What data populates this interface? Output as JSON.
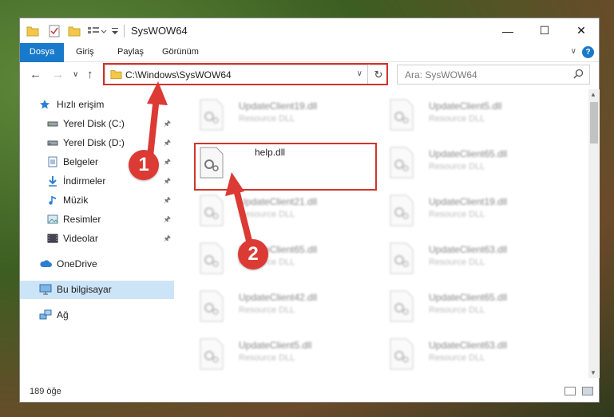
{
  "window": {
    "title": "SysWOW64",
    "controls": {
      "minimize": "—",
      "maximize": "☐",
      "close": "✕"
    }
  },
  "ribbon": {
    "tabs": [
      "Dosya",
      "Giriş",
      "Paylaş",
      "Görünüm"
    ],
    "help": "?"
  },
  "address": {
    "path": "C:\\Windows\\SysWOW64",
    "search_placeholder": "Ara: SysWOW64"
  },
  "nav": {
    "items": [
      {
        "label": "Hızlı erişim",
        "icon": "star-icon",
        "pinned": false
      },
      {
        "label": "Yerel Disk (C:)",
        "icon": "drive-icon",
        "pinned": true
      },
      {
        "label": "Yerel Disk (D:)",
        "icon": "drive-icon",
        "pinned": true
      },
      {
        "label": "Belgeler",
        "icon": "documents-icon",
        "pinned": true
      },
      {
        "label": "İndirmeler",
        "icon": "download-icon",
        "pinned": true
      },
      {
        "label": "Müzik",
        "icon": "music-icon",
        "pinned": true
      },
      {
        "label": "Resimler",
        "icon": "pictures-icon",
        "pinned": true
      },
      {
        "label": "Videolar",
        "icon": "videos-icon",
        "pinned": true
      },
      {
        "label": "OneDrive",
        "icon": "cloud-icon",
        "pinned": false
      },
      {
        "label": "Bu bilgisayar",
        "icon": "computer-icon",
        "pinned": false
      },
      {
        "label": "Ağ",
        "icon": "network-icon",
        "pinned": false
      }
    ]
  },
  "files": {
    "left_column": [
      {
        "name": "UpdateClient19.dll",
        "type": "Resource DLL"
      },
      {
        "name": "help.dll",
        "type": ""
      },
      {
        "name": "UpdateClient21.dll",
        "type": "Resource DLL"
      },
      {
        "name": "UpdateClient65.dll",
        "type": "Resource DLL"
      },
      {
        "name": "UpdateClient42.dll",
        "type": "Resource DLL"
      },
      {
        "name": "UpdateClient5.dll",
        "type": "Resource DLL"
      }
    ],
    "right_column": [
      {
        "name": "UpdateClient5.dll",
        "type": "Resource DLL"
      },
      {
        "name": "UpdateClient65.dll",
        "type": "Resource DLL"
      },
      {
        "name": "UpdateClient19.dll",
        "type": "Resource DLL"
      },
      {
        "name": "UpdateClient63.dll",
        "type": "Resource DLL"
      },
      {
        "name": "UpdateClient65.dll",
        "type": "Resource DLL"
      },
      {
        "name": "UpdateClient63.dll",
        "type": "Resource DLL"
      }
    ]
  },
  "status": {
    "count": "189 öğe"
  },
  "annotations": {
    "step1": "1",
    "step2": "2"
  },
  "colors": {
    "accent": "#1979ca",
    "highlight": "#d0342c",
    "selected": "#cce4f7"
  }
}
